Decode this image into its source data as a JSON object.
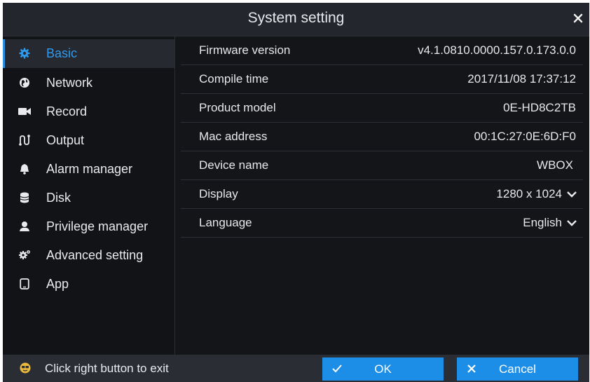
{
  "window": {
    "title": "System setting"
  },
  "sidebar": {
    "items": [
      {
        "label": "Basic",
        "icon": "gear-icon",
        "active": true
      },
      {
        "label": "Network",
        "icon": "globe-icon"
      },
      {
        "label": "Record",
        "icon": "video-camera-icon"
      },
      {
        "label": "Output",
        "icon": "output-icon"
      },
      {
        "label": "Alarm manager",
        "icon": "bell-icon"
      },
      {
        "label": "Disk",
        "icon": "database-icon"
      },
      {
        "label": "Privilege manager",
        "icon": "user-icon"
      },
      {
        "label": "Advanced setting",
        "icon": "gears-icon"
      },
      {
        "label": "App",
        "icon": "mobile-icon"
      }
    ]
  },
  "basic": {
    "rows": [
      {
        "key": "Firmware version",
        "value": "v4.1.0810.0000.157.0.173.0.0"
      },
      {
        "key": "Compile time",
        "value": "2017/11/08 17:37:12"
      },
      {
        "key": "Product model",
        "value": "0E-HD8C2TB"
      },
      {
        "key": "Mac address",
        "value": "00:1C:27:0E:6D:F0"
      },
      {
        "key": "Device name",
        "value": "WBOX"
      },
      {
        "key": "Display",
        "value": "1280 x 1024"
      },
      {
        "key": "Language",
        "value": "English"
      }
    ]
  },
  "footer": {
    "hint": "Click right button to exit",
    "ok_label": "OK",
    "cancel_label": "Cancel"
  },
  "colors": {
    "accent": "#1c8ee8",
    "active_text": "#2f9bf0",
    "background": "#141519",
    "titlebar": "#23262c",
    "footer": "#2a2d33"
  }
}
